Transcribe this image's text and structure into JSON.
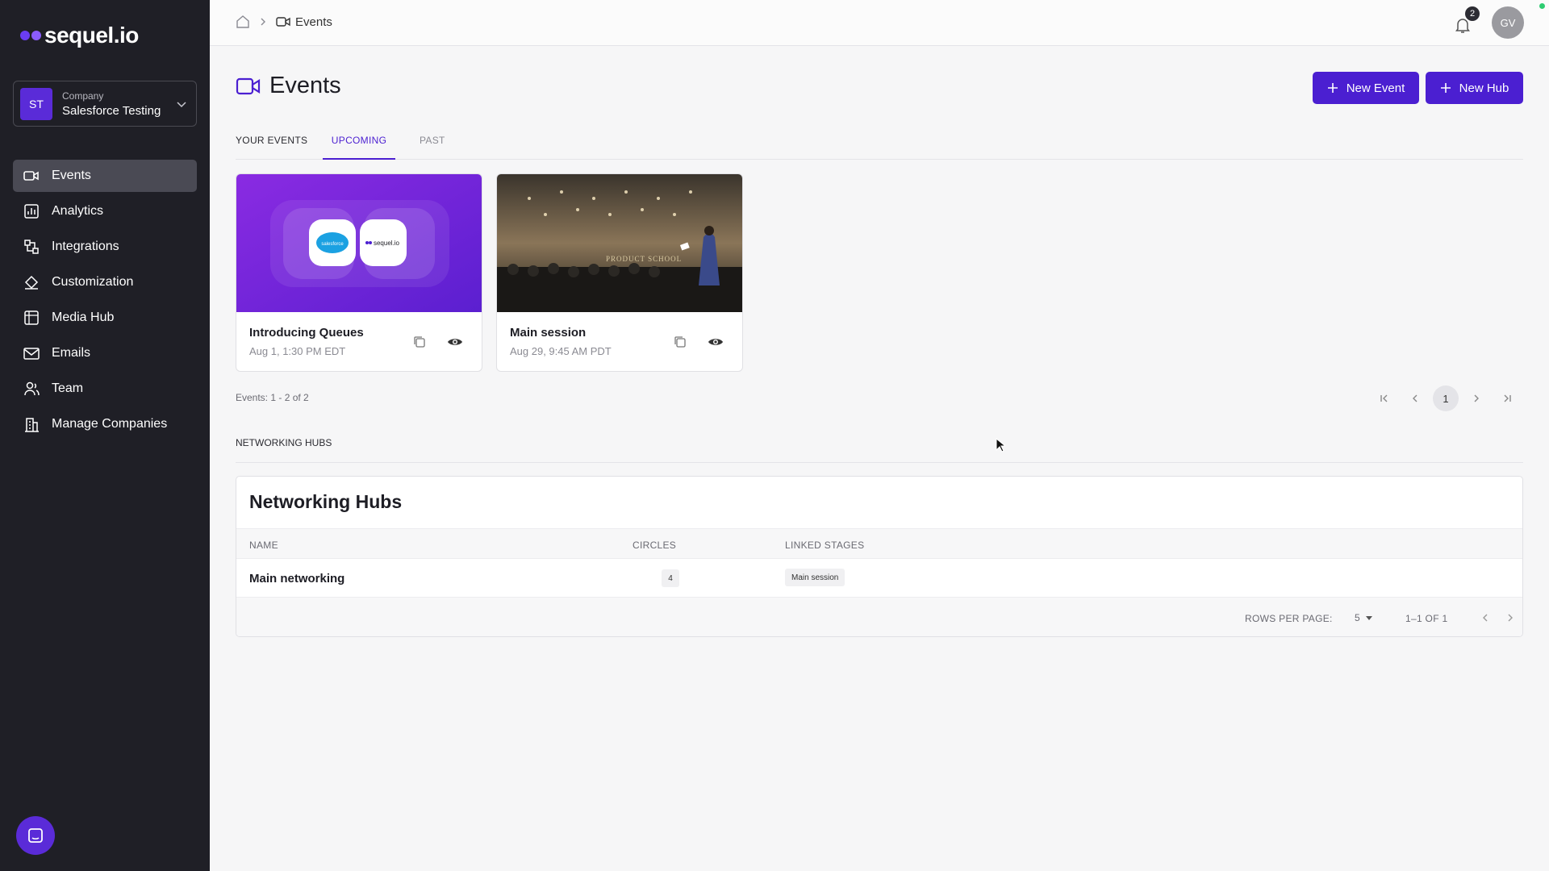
{
  "brand": {
    "name": "sequel.io"
  },
  "company": {
    "initials": "ST",
    "label": "Company",
    "name": "Salesforce Testing"
  },
  "sidebar": {
    "items": [
      {
        "label": "Events",
        "icon": "video-camera-icon",
        "active": true
      },
      {
        "label": "Analytics",
        "icon": "bar-chart-icon"
      },
      {
        "label": "Integrations",
        "icon": "integrations-icon"
      },
      {
        "label": "Customization",
        "icon": "paint-bucket-icon"
      },
      {
        "label": "Media Hub",
        "icon": "media-hub-icon"
      },
      {
        "label": "Emails",
        "icon": "envelope-icon"
      },
      {
        "label": "Team",
        "icon": "team-icon"
      },
      {
        "label": "Manage Companies",
        "icon": "building-icon"
      }
    ]
  },
  "topbar": {
    "breadcrumb_current": "Events",
    "notifications_count": "2",
    "user_initials": "GV"
  },
  "page": {
    "title": "Events",
    "new_event_label": "New Event",
    "new_hub_label": "New Hub"
  },
  "tabs": {
    "section": "YOUR EVENTS",
    "upcoming": "UPCOMING",
    "past": "PAST"
  },
  "events": [
    {
      "title": "Introducing Queues",
      "date": "Aug 1, 1:30 PM EDT",
      "logo_left": "salesforce",
      "logo_right": "sequel.io"
    },
    {
      "title": "Main session",
      "date": "Aug 29, 9:45 AM PDT",
      "photo_text": "PRODUCT SCHOOL"
    }
  ],
  "events_count": "Events: 1 - 2 of 2",
  "pagination": {
    "current_page": "1"
  },
  "hubs": {
    "section_label": "NETWORKING HUBS",
    "panel_title": "Networking Hubs",
    "columns": [
      "NAME",
      "CIRCLES",
      "LINKED STAGES"
    ],
    "rows": [
      {
        "name": "Main networking",
        "circles": "4",
        "linked_stage": "Main session"
      }
    ],
    "footer": {
      "rows_per_page_label": "ROWS PER PAGE:",
      "rows_per_page_value": "5",
      "range": "1–1 OF 1"
    }
  },
  "colors": {
    "accent": "#4b1fd1",
    "sidebar_bg": "#1f1f26",
    "online": "#2ecc71"
  }
}
